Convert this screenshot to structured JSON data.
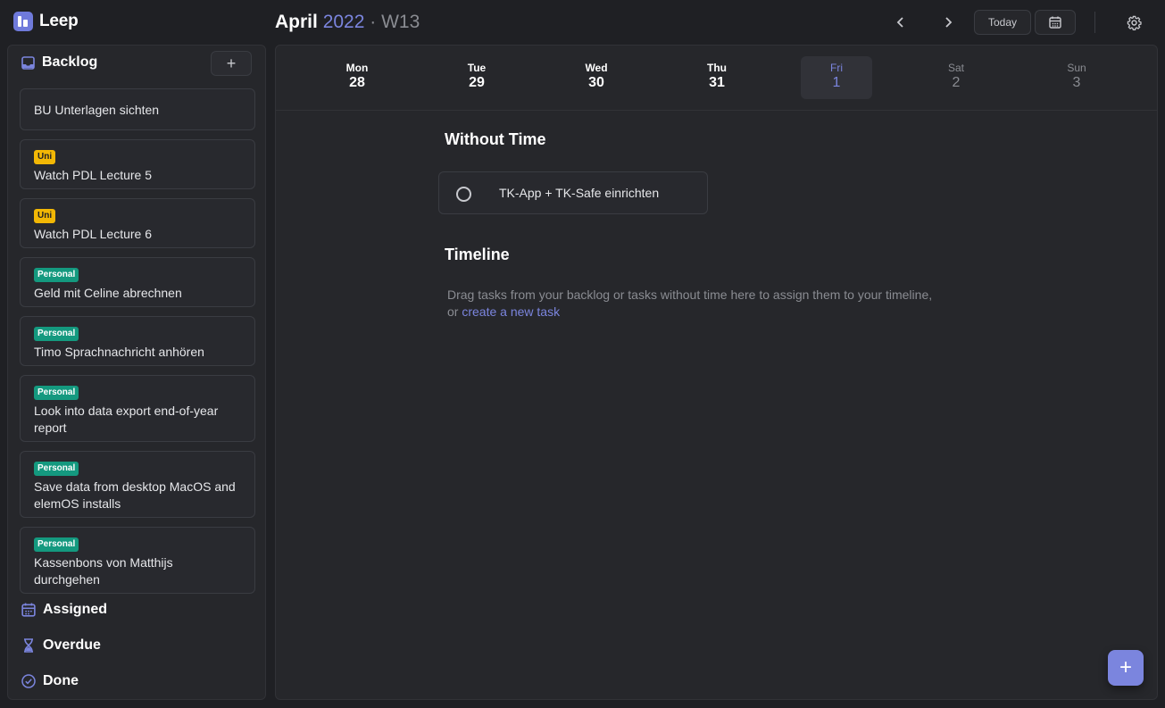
{
  "app": {
    "name": "Leep"
  },
  "header": {
    "month": "April",
    "year": "2022",
    "separator": " · ",
    "week": "W13",
    "today_label": "Today",
    "prev_symbol": "‹",
    "next_symbol": "›"
  },
  "sidebar": {
    "backlog_title": "Backlog",
    "add_symbol": "+",
    "tasks": [
      {
        "tag": "",
        "tag_type": "",
        "title": "BU Unterlagen sichten"
      },
      {
        "tag": "Uni",
        "tag_type": "uni",
        "title": "Watch PDL Lecture 5"
      },
      {
        "tag": "Uni",
        "tag_type": "uni",
        "title": "Watch PDL Lecture 6"
      },
      {
        "tag": "Personal",
        "tag_type": "personal",
        "title": "Geld mit Celine abrechnen"
      },
      {
        "tag": "Personal",
        "tag_type": "personal",
        "title": "Timo Sprachnachricht anhören"
      },
      {
        "tag": "Personal",
        "tag_type": "personal",
        "title": "Look into data export end-of-year report"
      },
      {
        "tag": "Personal",
        "tag_type": "personal",
        "title": "Save data from desktop MacOS and elemOS installs"
      },
      {
        "tag": "Personal",
        "tag_type": "personal",
        "title": "Kassenbons von Matthijs durchgehen"
      }
    ],
    "assigned_label": "Assigned",
    "overdue_label": "Overdue",
    "done_label": "Done"
  },
  "week_days": [
    {
      "name": "Mon",
      "date": "28",
      "state": "normal"
    },
    {
      "name": "Tue",
      "date": "29",
      "state": "normal"
    },
    {
      "name": "Wed",
      "date": "30",
      "state": "normal"
    },
    {
      "name": "Thu",
      "date": "31",
      "state": "normal"
    },
    {
      "name": "Fri",
      "date": "1",
      "state": "today"
    },
    {
      "name": "Sat",
      "date": "2",
      "state": "muted"
    },
    {
      "name": "Sun",
      "date": "3",
      "state": "muted"
    }
  ],
  "main": {
    "without_time_title": "Without Time",
    "without_time_task": "TK-App + TK-Safe einrichten",
    "timeline_title": "Timeline",
    "timeline_hint_line1": "Drag tasks from your backlog or tasks without time here to assign them to your timeline,",
    "timeline_hint_or": "or ",
    "timeline_hint_link": "create a new task",
    "fab_symbol": "+"
  },
  "colors": {
    "accent": "#7b85de",
    "tag_uni": "#f2b705",
    "tag_personal": "#14997f",
    "background": "#1f2024",
    "panel": "#26272b"
  }
}
